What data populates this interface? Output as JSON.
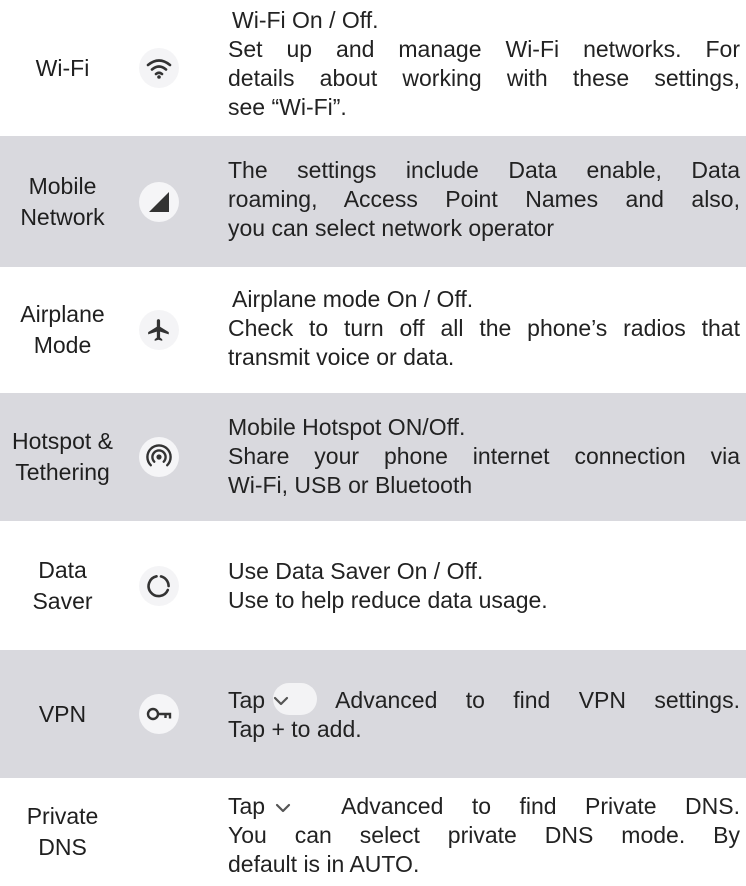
{
  "rows": [
    {
      "label": "Wi-Fi",
      "icon": "wifi-icon",
      "lines": [
        "Wi-Fi On / Off.",
        "Set up and manage Wi-Fi networks. For",
        "details about working with these settings,",
        "see “Wi-Fi”."
      ]
    },
    {
      "label_lines": [
        "Mobile",
        "Network"
      ],
      "icon": "signal-icon",
      "lines": [
        "The settings include Data enable, Data",
        "roaming, Access Point Names and also,",
        "you can select network operator"
      ]
    },
    {
      "label_lines": [
        "Airplane",
        "Mode"
      ],
      "icon": "airplane-icon",
      "lines": [
        "Airplane mode On / Off.",
        "Check to turn off all the phone’s radios that",
        "transmit voice or data."
      ]
    },
    {
      "label_lines": [
        "Hotspot &",
        "Tethering"
      ],
      "icon": "hotspot-icon",
      "lines": [
        "Mobile Hotspot ON/Off.",
        "Share your phone internet connection via",
        "Wi-Fi, USB or Bluetooth"
      ]
    },
    {
      "label_lines": [
        "Data",
        "Saver"
      ],
      "icon": "data-saver-icon",
      "lines": [
        "Use Data Saver On / Off.",
        "Use to help reduce data usage."
      ]
    },
    {
      "label": "VPN",
      "icon": "key-icon",
      "tap": "Tap",
      "after_chevron": "Advanced to find VPN settings.",
      "lines": [
        "Tap + to add."
      ]
    },
    {
      "label_lines": [
        "Private",
        "DNS"
      ],
      "icon": "",
      "tap": "Tap",
      "after_chevron": "Advanced to find Private DNS.",
      "lines": [
        "You can select private DNS mode. By",
        "default is in AUTO."
      ]
    }
  ]
}
